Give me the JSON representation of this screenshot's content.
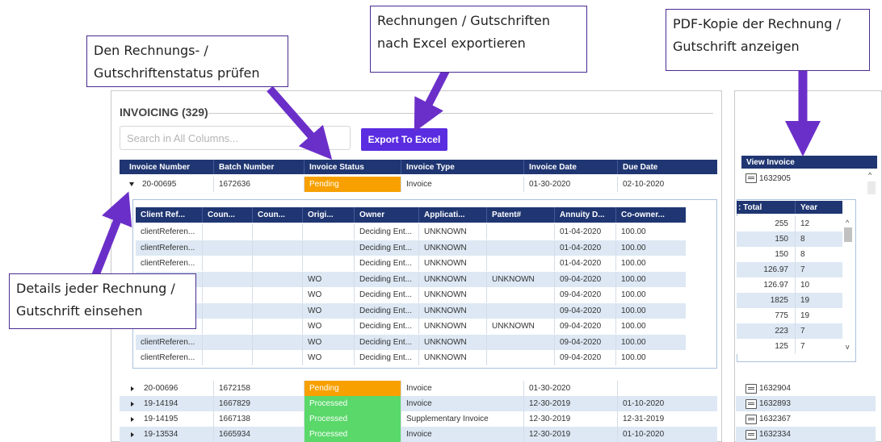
{
  "main": {
    "title": "INVOICING (329)",
    "search_placeholder": "Search in All Columns...",
    "export_label": "Export To Excel",
    "columns": [
      "Invoice Number",
      "Batch Number",
      "Invoice Status",
      "Invoice Type",
      "Invoice Date",
      "Due Date"
    ],
    "expanded_row": {
      "invoice_number": "20-00695",
      "batch": "1672636",
      "status": "Pending",
      "type": "Invoice",
      "invoice_date": "01-30-2020",
      "due_date": "02-10-2020"
    },
    "rows": [
      {
        "invoice_number": "20-00696",
        "batch": "1672158",
        "status": "Pending",
        "type": "Invoice",
        "invoice_date": "01-30-2020",
        "due_date": ""
      },
      {
        "invoice_number": "19-14194",
        "batch": "1667829",
        "status": "Processed",
        "type": "Invoice",
        "invoice_date": "12-30-2019",
        "due_date": "01-10-2020"
      },
      {
        "invoice_number": "19-14195",
        "batch": "1667138",
        "status": "Processed",
        "type": "Supplementary Invoice",
        "invoice_date": "12-30-2019",
        "due_date": "12-31-2019"
      },
      {
        "invoice_number": "19-13534",
        "batch": "1665934",
        "status": "Processed",
        "type": "Invoice",
        "invoice_date": "12-30-2019",
        "due_date": "01-10-2020"
      }
    ]
  },
  "detail": {
    "columns": [
      "Client Ref...",
      "Coun...",
      "Coun...",
      "Origi...",
      "Owner",
      "Applicati...",
      "Patent#",
      "Annuity D...",
      "Co-owner..."
    ],
    "rows": [
      [
        "clientReferen...",
        "",
        "",
        "",
        "Deciding Ent...",
        "UNKNOWN",
        "",
        "01-04-2020",
        "100.00"
      ],
      [
        "clientReferen...",
        "",
        "",
        "",
        "Deciding Ent...",
        "UNKNOWN",
        "",
        "01-04-2020",
        "100.00"
      ],
      [
        "clientReferen...",
        "",
        "",
        "",
        "Deciding Ent...",
        "UNKNOWN",
        "",
        "01-04-2020",
        "100.00"
      ],
      [
        "",
        "",
        "",
        "WO",
        "Deciding Ent...",
        "UNKNOWN",
        "UNKNOWN",
        "09-04-2020",
        "100.00"
      ],
      [
        "",
        "",
        "",
        "WO",
        "Deciding Ent...",
        "UNKNOWN",
        "",
        "09-04-2020",
        "100.00"
      ],
      [
        "",
        "",
        "",
        "WO",
        "Deciding Ent...",
        "UNKNOWN",
        "",
        "09-04-2020",
        "100.00"
      ],
      [
        "",
        "",
        "",
        "WO",
        "Deciding Ent...",
        "UNKNOWN",
        "UNKNOWN",
        "09-04-2020",
        "100.00"
      ],
      [
        "clientReferen...",
        "",
        "",
        "WO",
        "Deciding Ent...",
        "UNKNOWN",
        "",
        "09-04-2020",
        "100.00"
      ],
      [
        "clientReferen...",
        "",
        "",
        "WO",
        "Deciding Ent...",
        "UNKNOWN",
        "",
        "09-04-2020",
        "100.00"
      ]
    ]
  },
  "right": {
    "view_invoice_label": "View Invoice",
    "first_invoice": "1632905",
    "columns": [
      ": Total",
      "Year"
    ],
    "totals": [
      [
        "255",
        "12"
      ],
      [
        "150",
        "8"
      ],
      [
        "150",
        "8"
      ],
      [
        "126.97",
        "7"
      ],
      [
        "126.97",
        "10"
      ],
      [
        "1825",
        "19"
      ],
      [
        "775",
        "19"
      ],
      [
        "223",
        "7"
      ],
      [
        "125",
        "7"
      ]
    ],
    "invoices": [
      "1632904",
      "1632893",
      "1632367",
      "1632334"
    ]
  },
  "callouts": {
    "export": "Rechnungen / Gutschriften\nnach Excel exportieren",
    "status": "Den Rechnungs- /\nGutschriftenstatus prüfen",
    "pdf": "PDF-Kopie der Rechnung /\nGutschrift anzeigen",
    "details": "Details jeder Rechnung /\nGutschrift einsehen"
  },
  "colors": {
    "header": "#1f3672",
    "pending": "#f7a000",
    "processed": "#5ad86a",
    "export_button": "#5a2de0",
    "arrow": "#6b2fc9"
  }
}
